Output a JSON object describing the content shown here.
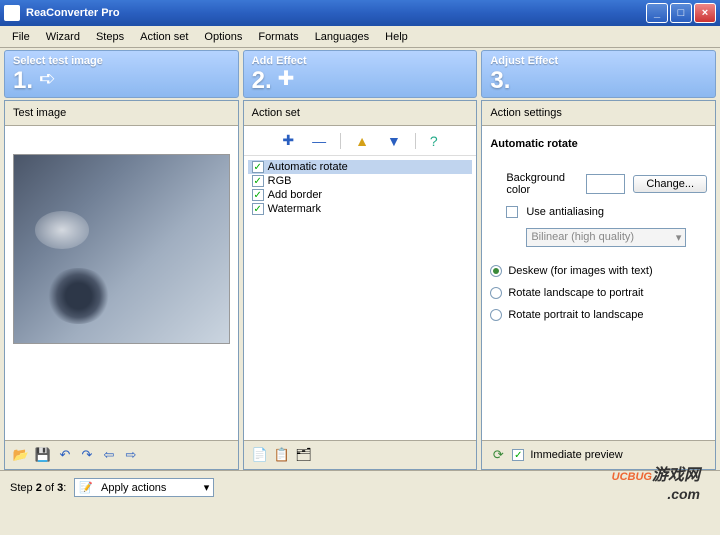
{
  "window": {
    "title": "ReaConverter Pro"
  },
  "menu": [
    "File",
    "Wizard",
    "Steps",
    "Action set",
    "Options",
    "Formats",
    "Languages",
    "Help"
  ],
  "steps": [
    {
      "num": "1.",
      "title": "Select test image"
    },
    {
      "num": "2.",
      "title": "Add Effect"
    },
    {
      "num": "3.",
      "title": "Adjust Effect"
    }
  ],
  "panels": {
    "left": {
      "title": "Test image"
    },
    "middle": {
      "title": "Action set",
      "actions": [
        {
          "label": "Automatic rotate",
          "checked": true,
          "selected": true
        },
        {
          "label": "RGB",
          "checked": true,
          "selected": false
        },
        {
          "label": "Add border",
          "checked": true,
          "selected": false
        },
        {
          "label": "Watermark",
          "checked": true,
          "selected": false
        }
      ]
    },
    "right": {
      "title": "Action settings",
      "section_title": "Automatic rotate",
      "bg_label": "Background color",
      "change_btn": "Change...",
      "antialias_label": "Use antialiasing",
      "antialias_checked": false,
      "quality_select": "Bilinear (high quality)",
      "radios": [
        {
          "label": "Deskew (for images with text)",
          "checked": true
        },
        {
          "label": "Rotate landscape to portrait",
          "checked": false
        },
        {
          "label": "Rotate portrait to landscape",
          "checked": false
        }
      ],
      "immediate_label": "Immediate preview",
      "immediate_checked": true
    }
  },
  "bottom": {
    "step_text_pre": "Step ",
    "step_current": "2",
    "step_text_mid": " of ",
    "step_total": "3",
    "step_text_post": ":",
    "apply_label": "Apply actions"
  },
  "watermark": {
    "a": "UC",
    "b": "BUG",
    "c": "游戏网",
    "d": ".com"
  }
}
